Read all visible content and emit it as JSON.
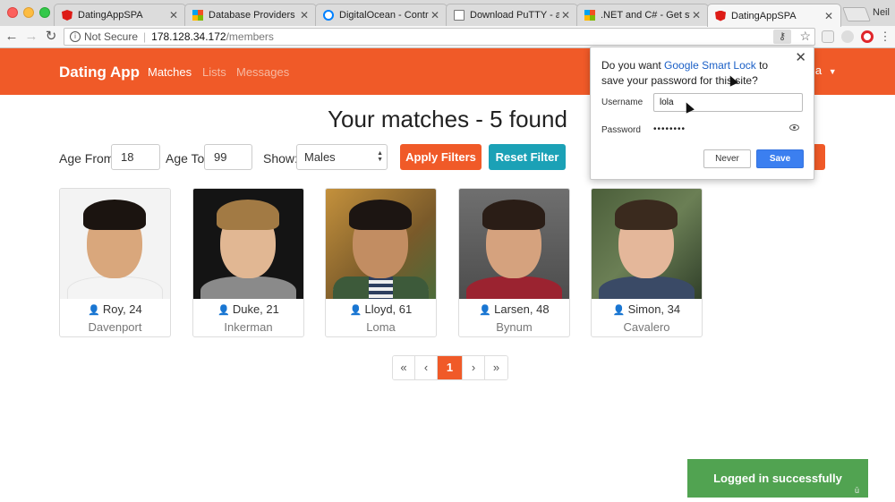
{
  "browser": {
    "tabs": [
      {
        "label": "DatingAppSPA",
        "favicon": "angular-icon"
      },
      {
        "label": "Database Providers - El",
        "favicon": "microsoft-icon"
      },
      {
        "label": "DigitalOcean - Control",
        "favicon": "digitalocean-icon"
      },
      {
        "label": "Download PuTTY - a fre",
        "favicon": "document-icon"
      },
      {
        "label": ".NET and C# - Get start",
        "favicon": "microsoft-icon"
      },
      {
        "label": "DatingAppSPA",
        "favicon": "angular-icon",
        "active": true
      }
    ],
    "profile": "Neil",
    "url_security": "Not Secure",
    "url_host": "178.128.34.172",
    "url_path": "/members"
  },
  "navbar": {
    "brand": "Dating App",
    "links": [
      "Matches",
      "Lists",
      "Messages"
    ],
    "user_fragment": "la"
  },
  "heading": "Your matches - 5 found",
  "filters": {
    "age_from_label": "Age From",
    "age_from": "18",
    "age_to_label": "Age To",
    "age_to": "99",
    "show_label": "Show:",
    "show_value": "Males",
    "apply_label": "Apply Filters",
    "reset_label": "Reset Filter"
  },
  "members": [
    {
      "name_age": "Roy, 24",
      "city": "Davenport"
    },
    {
      "name_age": "Duke, 21",
      "city": "Inkerman"
    },
    {
      "name_age": "Lloyd, 61",
      "city": "Loma"
    },
    {
      "name_age": "Larsen, 48",
      "city": "Bynum"
    },
    {
      "name_age": "Simon, 34",
      "city": "Cavalero"
    }
  ],
  "pagination": {
    "first": "«",
    "prev": "‹",
    "current": "1",
    "next": "›",
    "last": "»"
  },
  "toast": "Logged in successfully",
  "smartlock": {
    "question_pre": "Do you want ",
    "question_link": "Google Smart Lock",
    "question_post": " to save your password for this site?",
    "username_label": "Username",
    "username_value": "lola",
    "password_label": "Password",
    "password_mask": "••••••••",
    "never_label": "Never",
    "save_label": "Save"
  },
  "colors": {
    "brand": "#f05a28",
    "teal": "#1ba1b6",
    "toast": "#51a351",
    "save": "#3b7ff0"
  }
}
